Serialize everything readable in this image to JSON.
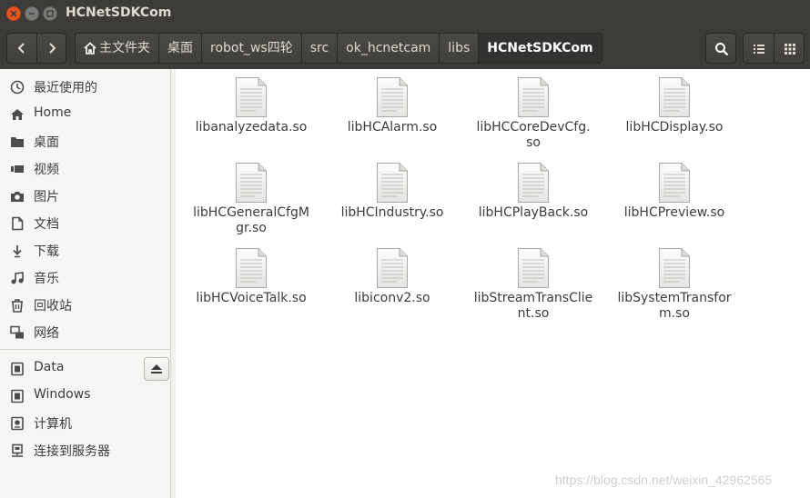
{
  "window": {
    "title": "HCNetSDKCom"
  },
  "breadcrumbs": [
    {
      "label": "主文件夹",
      "home": true
    },
    {
      "label": "桌面"
    },
    {
      "label": "robot_ws四轮"
    },
    {
      "label": "src"
    },
    {
      "label": "ok_hcnetcam"
    },
    {
      "label": "libs"
    },
    {
      "label": "HCNetSDKCom",
      "active": true
    }
  ],
  "sidebar": {
    "places": [
      {
        "label": "最近使用的",
        "icon": "clock-icon"
      },
      {
        "label": "Home",
        "icon": "home-icon"
      },
      {
        "label": "桌面",
        "icon": "folder-icon"
      },
      {
        "label": "视频",
        "icon": "video-icon"
      },
      {
        "label": "图片",
        "icon": "camera-icon"
      },
      {
        "label": "文档",
        "icon": "document-icon"
      },
      {
        "label": "下载",
        "icon": "download-icon"
      },
      {
        "label": "音乐",
        "icon": "music-icon"
      },
      {
        "label": "回收站",
        "icon": "trash-icon"
      },
      {
        "label": "网络",
        "icon": "network-icon"
      }
    ],
    "devices": [
      {
        "label": "Data",
        "icon": "drive-icon"
      },
      {
        "label": "Windows",
        "icon": "drive-icon"
      },
      {
        "label": "计算机",
        "icon": "computer-icon"
      },
      {
        "label": "连接到服务器",
        "icon": "server-icon"
      }
    ]
  },
  "files": [
    {
      "line1": "libanalyzedata.so",
      "line2": ""
    },
    {
      "line1": "libHCAlarm.so",
      "line2": ""
    },
    {
      "line1": "libHCCoreDevCfg.",
      "line2": "so"
    },
    {
      "line1": "libHCDisplay.so",
      "line2": ""
    },
    {
      "line1": "libHCGeneralCfgM",
      "line2": "gr.so"
    },
    {
      "line1": "libHCIndustry.so",
      "line2": ""
    },
    {
      "line1": "libHCPlayBack.so",
      "line2": ""
    },
    {
      "line1": "libHCPreview.so",
      "line2": ""
    },
    {
      "line1": "libHCVoiceTalk.so",
      "line2": ""
    },
    {
      "line1": "libiconv2.so",
      "line2": ""
    },
    {
      "line1": "libStreamTransClie",
      "line2": "nt.so"
    },
    {
      "line1": "libSystemTransfor",
      "line2": "m.so"
    }
  ],
  "watermark": "https://blog.csdn.net/weixin_42962565",
  "colors": {
    "accent": "#e95420",
    "titlebar": "#3c3b37"
  }
}
